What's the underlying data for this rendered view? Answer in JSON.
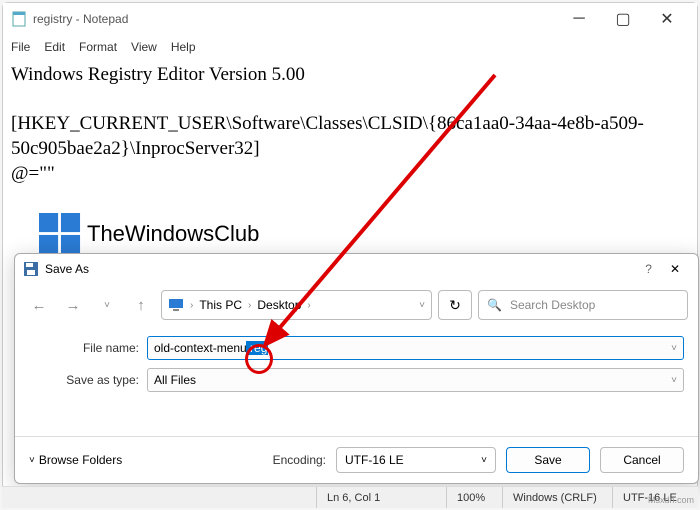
{
  "notepad": {
    "title": "registry - Notepad",
    "menubar": [
      "File",
      "Edit",
      "Format",
      "View",
      "Help"
    ],
    "content_line1": "Windows Registry Editor Version 5.00",
    "content_line2": "[HKEY_CURRENT_USER\\Software\\Classes\\CLSID\\{86ca1aa0-34aa-4e8b-a509-50c905bae2a2}\\InprocServer32]",
    "content_line3": "@=\"\""
  },
  "brand": {
    "text": "TheWindowsClub"
  },
  "saveas": {
    "title": "Save As",
    "breadcrumb": {
      "pc": "This PC",
      "folder": "Desktop"
    },
    "search_placeholder": "Search Desktop",
    "filename_label": "File name:",
    "filename_value": "old-context-menu",
    "filename_sel": ".reg",
    "type_label": "Save as type:",
    "type_value": "All Files",
    "browse_label": "Browse Folders",
    "encoding_label": "Encoding:",
    "encoding_value": "UTF-16 LE",
    "save_label": "Save",
    "cancel_label": "Cancel"
  },
  "statusbar": {
    "pos": "Ln 6, Col 1",
    "zoom": "100%",
    "eol": "Windows (CRLF)",
    "enc": "UTF-16 LE"
  },
  "watermark": "Msxdn.com"
}
